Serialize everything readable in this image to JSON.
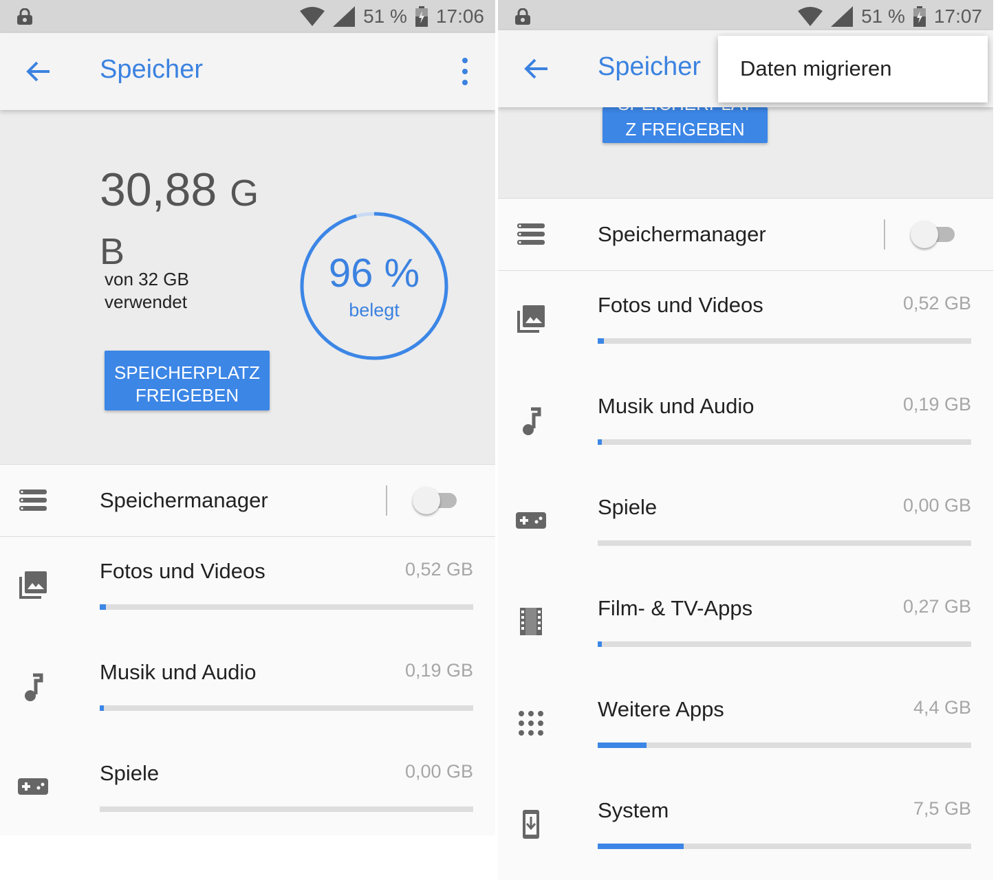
{
  "screens": [
    {
      "status": {
        "battery": "51 %",
        "time": "17:06"
      },
      "appbar": {
        "title": "Speicher"
      },
      "summary": {
        "used_value": "30,88",
        "used_unit_g": "G",
        "used_unit_b": "B",
        "used_of": "von 32 GB verwendet",
        "percent": "96 %",
        "percent_value": 0.96,
        "percent_label": "belegt",
        "free_button": "SPEICHERPLATZ FREIGEBEN"
      },
      "manager": {
        "label": "Speichermanager",
        "enabled": false
      },
      "categories": [
        {
          "label": "Fotos und Videos",
          "size": "0,52 GB",
          "fraction": 0.016,
          "icon": "photo-library-icon"
        },
        {
          "label": "Musik und Audio",
          "size": "0,19 GB",
          "fraction": 0.006,
          "icon": "music-note-icon"
        },
        {
          "label": "Spiele",
          "size": "0,00 GB",
          "fraction": 0.0,
          "icon": "gamepad-icon"
        }
      ]
    },
    {
      "status": {
        "battery": "51 %",
        "time": "17:07"
      },
      "appbar": {
        "title": "Speicher"
      },
      "summary": {
        "free_button_partial": "SPEICHERPLAT",
        "free_button_tail": "Z FREIGEBEN"
      },
      "menu": {
        "item": "Daten migrieren"
      },
      "manager": {
        "label": "Speichermanager",
        "enabled": false
      },
      "categories": [
        {
          "label": "Fotos und Videos",
          "size": "0,52 GB",
          "fraction": 0.016,
          "icon": "photo-library-icon"
        },
        {
          "label": "Musik und Audio",
          "size": "0,19 GB",
          "fraction": 0.006,
          "icon": "music-note-icon"
        },
        {
          "label": "Spiele",
          "size": "0,00 GB",
          "fraction": 0.0,
          "icon": "gamepad-icon"
        },
        {
          "label": "Film- & TV-Apps",
          "size": "0,27 GB",
          "fraction": 0.008,
          "icon": "movie-icon"
        },
        {
          "label": "Weitere Apps",
          "size": "4,4 GB",
          "fraction": 0.13,
          "icon": "apps-grid-icon"
        },
        {
          "label": "System",
          "size": "7,5 GB",
          "fraction": 0.23,
          "icon": "system-update-icon"
        }
      ]
    }
  ],
  "colors": {
    "accent": "#3c86e6",
    "title": "#3b82e0",
    "statusbar": "#d6d6d6",
    "appbar": "#f4f4f4",
    "summary_bg": "#ececec"
  }
}
